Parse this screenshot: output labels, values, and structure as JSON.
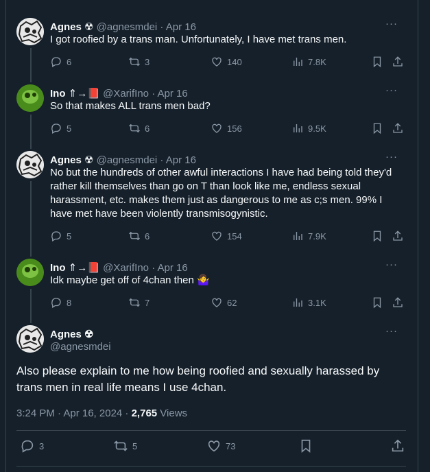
{
  "tweets": [
    {
      "name": "Agnes",
      "badge": "☢",
      "handle": "@agnesmdei",
      "date": "Apr 16",
      "text": "I got roofied by a trans man. Unfortunately, I have met trans men.",
      "replies": "6",
      "reposts": "3",
      "likes": "140",
      "views": "7.8K"
    },
    {
      "name": "Ino",
      "badge": "⇑→📕",
      "handle": "@XarifIno",
      "date": "Apr 16",
      "text": "So that makes ALL trans men bad?",
      "replies": "5",
      "reposts": "6",
      "likes": "156",
      "views": "9.5K"
    },
    {
      "name": "Agnes",
      "badge": "☢",
      "handle": "@agnesmdei",
      "date": "Apr 16",
      "text": "No but the hundreds of other awful interactions I have had being told they'd rather kill themselves than go on T than look like me, endless sexual harassment, etc. makes them just as dangerous to me as c;s men. 99% I have met have been violently transmisogynistic.",
      "replies": "5",
      "reposts": "6",
      "likes": "154",
      "views": "7.9K"
    },
    {
      "name": "Ino",
      "badge": "⇑→📕",
      "handle": "@XarifIno",
      "date": "Apr 16",
      "text": "Idk maybe get off of 4chan then 🤷‍♀️",
      "replies": "8",
      "reposts": "7",
      "likes": "62",
      "views": "3.1K"
    }
  ],
  "main": {
    "name": "Agnes",
    "badge": "☢",
    "handle": "@agnesmdei",
    "text": "Also please explain to me how being roofied and sexually harassed by trans men in real life means I use 4chan.",
    "time": "3:24 PM · Apr 16, 2024 · ",
    "views_count": "2,765",
    "views_label": " Views",
    "replies": "3",
    "reposts": "5",
    "likes": "73"
  },
  "more_glyph": "···",
  "colors": {
    "background": "#15202b",
    "text": "#f7f9f9",
    "muted": "#8b98a5",
    "border": "#38444d"
  }
}
